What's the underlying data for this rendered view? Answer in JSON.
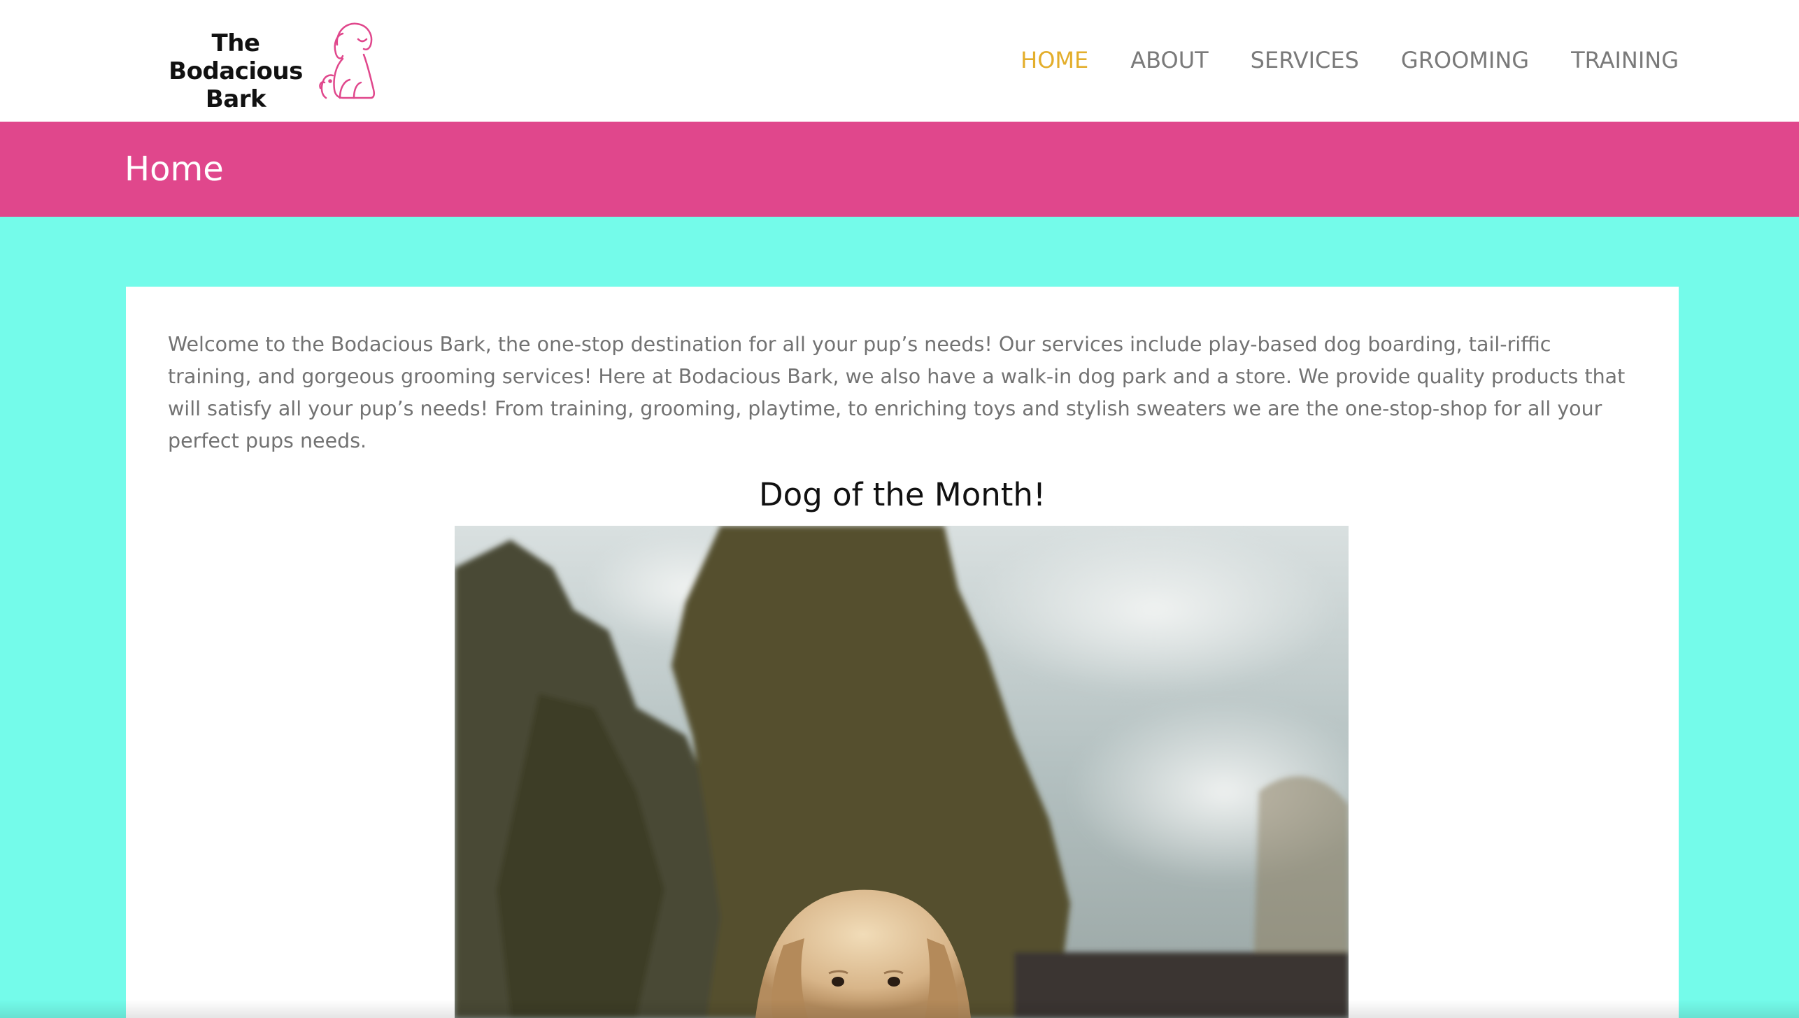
{
  "brand": {
    "line1": "The Bodacious",
    "line2": "Bark",
    "logo_icon": "dog-outline-icon",
    "accent_color": "#e0478c"
  },
  "nav": {
    "items": [
      {
        "label": "HOME",
        "active": true
      },
      {
        "label": "ABOUT",
        "active": false
      },
      {
        "label": "SERVICES",
        "active": false
      },
      {
        "label": "GROOMING",
        "active": false
      },
      {
        "label": "TRAINING",
        "active": false
      }
    ],
    "active_color": "#e3ae2b",
    "inactive_color": "#7a7a7a"
  },
  "page": {
    "title": "Home",
    "title_bar_color": "#e0478c",
    "background_color": "#74fbea"
  },
  "content": {
    "intro": "Welcome to the Bodacious Bark, the one-stop destination for all your pup’s needs! Our services include play-based dog boarding, tail-riffic training, and gorgeous grooming services! Here at Bodacious Bark, we also have a walk-in dog park and a store. We provide quality products that will satisfy all your pup’s needs! From training, grooming, playtime, to enriching toys and stylish sweaters we are the one-stop-shop for all your perfect pups needs.",
    "feature_heading": "Dog of the Month!"
  }
}
